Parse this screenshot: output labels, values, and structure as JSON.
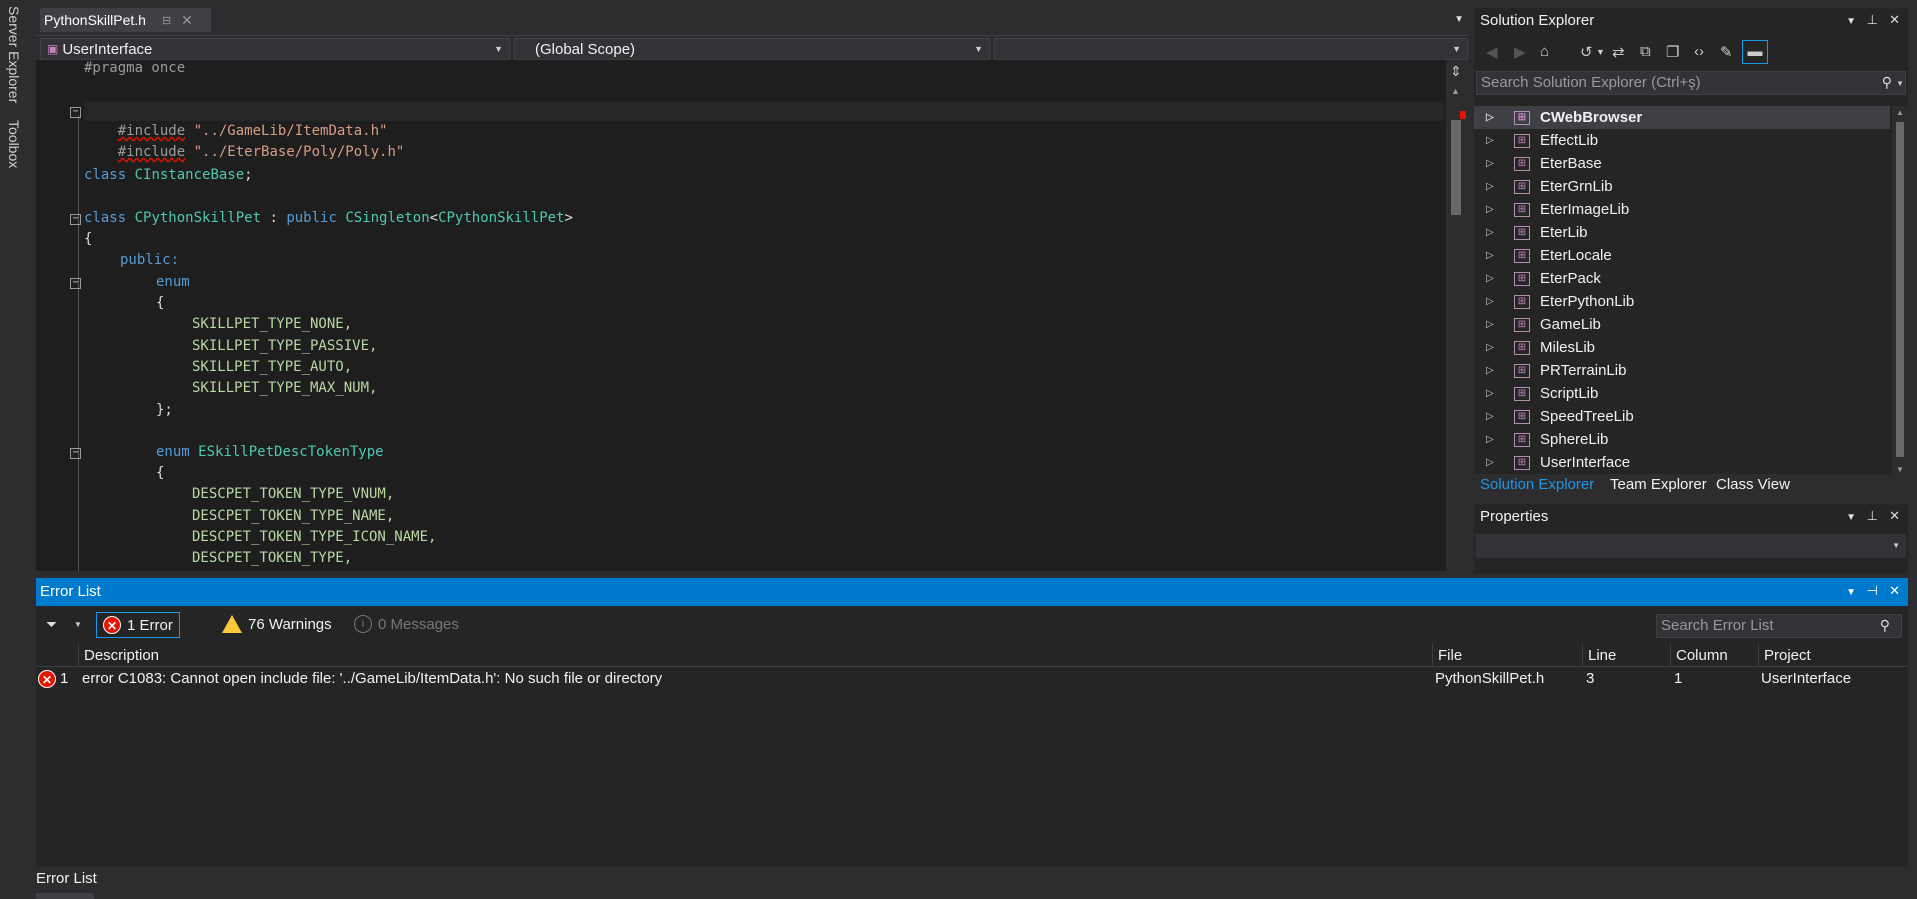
{
  "left_strip": {
    "server_explorer": "Server Explorer",
    "toolbox": "Toolbox"
  },
  "editor": {
    "tab_title": "PythonSkillPet.h",
    "nav": {
      "project": "UserInterface",
      "scope": "(Global Scope)",
      "member": ""
    },
    "lines": [
      {
        "text": "#pragma once"
      },
      {
        "text": "#include \"../GameLib/ItemData.h\""
      },
      {
        "text": "#include \"../EterBase/Poly/Poly.h\""
      },
      {
        "text": "class CInstanceBase;"
      },
      {
        "text": "class CPythonSkillPet : public CSingleton<CPythonSkillPet>"
      },
      {
        "text": "{"
      },
      {
        "text": "public:"
      },
      {
        "text": "enum"
      },
      {
        "text": "{"
      },
      {
        "text": "SKILLPET_TYPE_NONE,"
      },
      {
        "text": "SKILLPET_TYPE_PASSIVE,"
      },
      {
        "text": "SKILLPET_TYPE_AUTO,"
      },
      {
        "text": "SKILLPET_TYPE_MAX_NUM,"
      },
      {
        "text": "};"
      },
      {
        "text": "enum ESkillPetDescTokenType"
      },
      {
        "text": "{"
      },
      {
        "text": "DESCPET_TOKEN_TYPE_VNUM,"
      },
      {
        "text": "DESCPET_TOKEN_TYPE_NAME,"
      },
      {
        "text": "DESCPET_TOKEN_TYPE_ICON_NAME,"
      },
      {
        "text": "DESCPET_TOKEN_TYPE,"
      }
    ]
  },
  "solution_explorer": {
    "title": "Solution Explorer",
    "search_placeholder": "Search Solution Explorer (Ctrl+ş)",
    "items": [
      "CWebBrowser",
      "EffectLib",
      "EterBase",
      "EterGrnLib",
      "EterImageLib",
      "EterLib",
      "EterLocale",
      "EterPack",
      "EterPythonLib",
      "GameLib",
      "MilesLib",
      "PRTerrainLib",
      "ScriptLib",
      "SpeedTreeLib",
      "SphereLib",
      "UserInterface"
    ],
    "tabs": [
      "Solution Explorer",
      "Team Explorer",
      "Class View"
    ]
  },
  "properties": {
    "title": "Properties"
  },
  "error_list": {
    "title": "Error List",
    "errors_label": "1 Error",
    "warnings_label": "76 Warnings",
    "messages_label": "0 Messages",
    "search_placeholder": "Search Error List",
    "columns": [
      "Description",
      "File",
      "Line",
      "Column",
      "Project"
    ],
    "rows": [
      {
        "index": "1",
        "description": "error C1083: Cannot open include file: '../GameLib/ItemData.h': No such file or directory",
        "file": "PythonSkillPet.h",
        "line": "3",
        "column": "1",
        "project": "UserInterface"
      }
    ]
  },
  "bottom_tab": "Error List",
  "colors": {
    "accent": "#007acc",
    "error": "#e51400",
    "warning": "#fcc93b",
    "keyword": "#569cd6",
    "type": "#4ec9b0",
    "string": "#d69d85",
    "enum": "#b8d7a3"
  }
}
